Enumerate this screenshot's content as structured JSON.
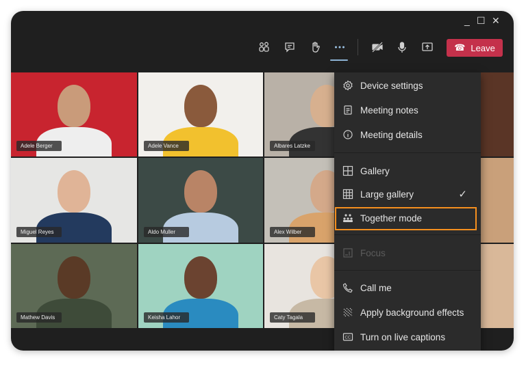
{
  "window_controls": {
    "minimize": "_",
    "maximize": "☐",
    "close": "✕"
  },
  "toolbar": {
    "items": [
      {
        "name": "participants-icon"
      },
      {
        "name": "chat-icon"
      },
      {
        "name": "raise-hand-icon"
      },
      {
        "name": "more-actions-icon",
        "active": true
      },
      {
        "name": "camera-off-icon"
      },
      {
        "name": "microphone-icon"
      },
      {
        "name": "share-screen-icon"
      }
    ],
    "leave_label": "Leave",
    "leave_color": "#c4314b"
  },
  "participants": [
    {
      "name": "Adele Berger",
      "bg": "#c8242f"
    },
    {
      "name": "Adele Vance",
      "bg": "#f2f0ec"
    },
    {
      "name": "Albares Latzke",
      "bg": "#b9b1a7"
    },
    {
      "name": "Miguel Reyes",
      "bg": "#e6e6e4"
    },
    {
      "name": "Aldo Muller",
      "bg": "#3c4a46"
    },
    {
      "name": "Alex Wilber",
      "bg": "#c4c0b8"
    },
    {
      "name": "Mathew Davis",
      "bg": "#5d6a55"
    },
    {
      "name": "Keisha Lahor",
      "bg": "#9fd3c1"
    },
    {
      "name": "Caty Tagala",
      "bg": "#e8e4df"
    }
  ],
  "menu": {
    "items": [
      {
        "label": "Device settings",
        "icon": "gear-icon"
      },
      {
        "label": "Meeting notes",
        "icon": "notes-icon"
      },
      {
        "label": "Meeting details",
        "icon": "info-icon"
      },
      {
        "label": "Gallery",
        "icon": "gallery-icon"
      },
      {
        "label": "Large gallery",
        "icon": "large-gallery-icon",
        "checked": true
      },
      {
        "label": "Together mode",
        "icon": "together-mode-icon",
        "highlighted": true
      },
      {
        "label": "Focus",
        "icon": "focus-icon",
        "disabled": true
      },
      {
        "label": "Call me",
        "icon": "phone-icon"
      },
      {
        "label": "Apply background effects",
        "icon": "background-effects-icon"
      },
      {
        "label": "Turn on live captions",
        "icon": "captions-icon"
      }
    ],
    "check": "✓",
    "highlight_color": "#f6901e"
  }
}
